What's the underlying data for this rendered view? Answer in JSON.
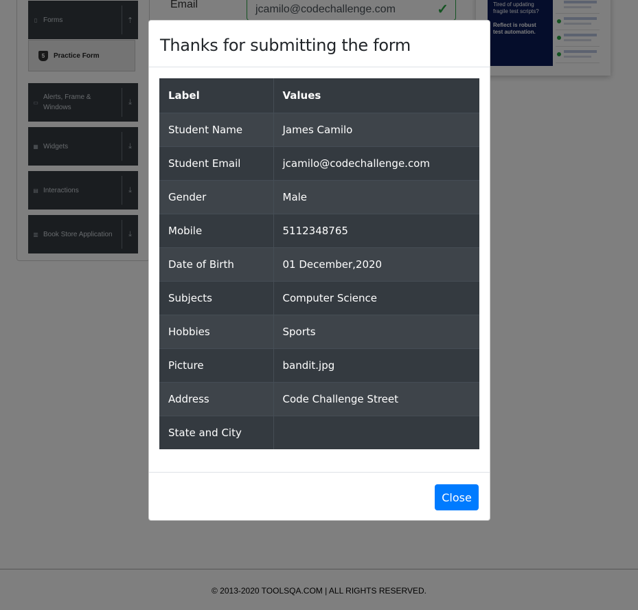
{
  "sidebar": {
    "groups": [
      {
        "label": "Forms",
        "icon": "document-icon",
        "toggle": "expand-up-icon"
      },
      {
        "label": "Alerts, Frame & Windows",
        "icon": "window-icon",
        "toggle": "download-icon"
      },
      {
        "label": "Widgets",
        "icon": "grid-icon",
        "toggle": "download-icon"
      },
      {
        "label": "Interactions",
        "icon": "list-icon",
        "toggle": "download-icon"
      },
      {
        "label": "Book Store Application",
        "icon": "books-icon",
        "toggle": "download-icon"
      }
    ],
    "active_item": {
      "label": "Practice Form",
      "icon": "html5-icon"
    }
  },
  "form": {
    "email_label": "Email",
    "email_value": "jcamilo@codechallenge.com"
  },
  "ad": {
    "line1": "Tired of updating fragile test scripts?",
    "line2": "Reflect is robust test automation."
  },
  "modal": {
    "title": "Thanks for submitting the form",
    "table": {
      "headers": {
        "label": "Label",
        "values": "Values"
      },
      "rows": [
        {
          "label": "Student Name",
          "value": "James Camilo"
        },
        {
          "label": "Student Email",
          "value": "jcamilo@codechallenge.com"
        },
        {
          "label": "Gender",
          "value": "Male"
        },
        {
          "label": "Mobile",
          "value": "5112348765"
        },
        {
          "label": "Date of Birth",
          "value": "01 December,2020"
        },
        {
          "label": "Subjects",
          "value": "Computer Science"
        },
        {
          "label": "Hobbies",
          "value": "Sports"
        },
        {
          "label": "Picture",
          "value": "bandit.jpg"
        },
        {
          "label": "Address",
          "value": "Code Challenge Street"
        },
        {
          "label": "State and City",
          "value": ""
        }
      ]
    },
    "close_label": "Close"
  },
  "footer": {
    "text": "© 2013-2020 TOOLSQA.COM | ALL RIGHTS RESERVED."
  },
  "colors": {
    "primary": "#007bff",
    "table_dark": "#343a40",
    "success": "#28a745",
    "backdrop": "rgba(0,0,0,0.5)"
  }
}
